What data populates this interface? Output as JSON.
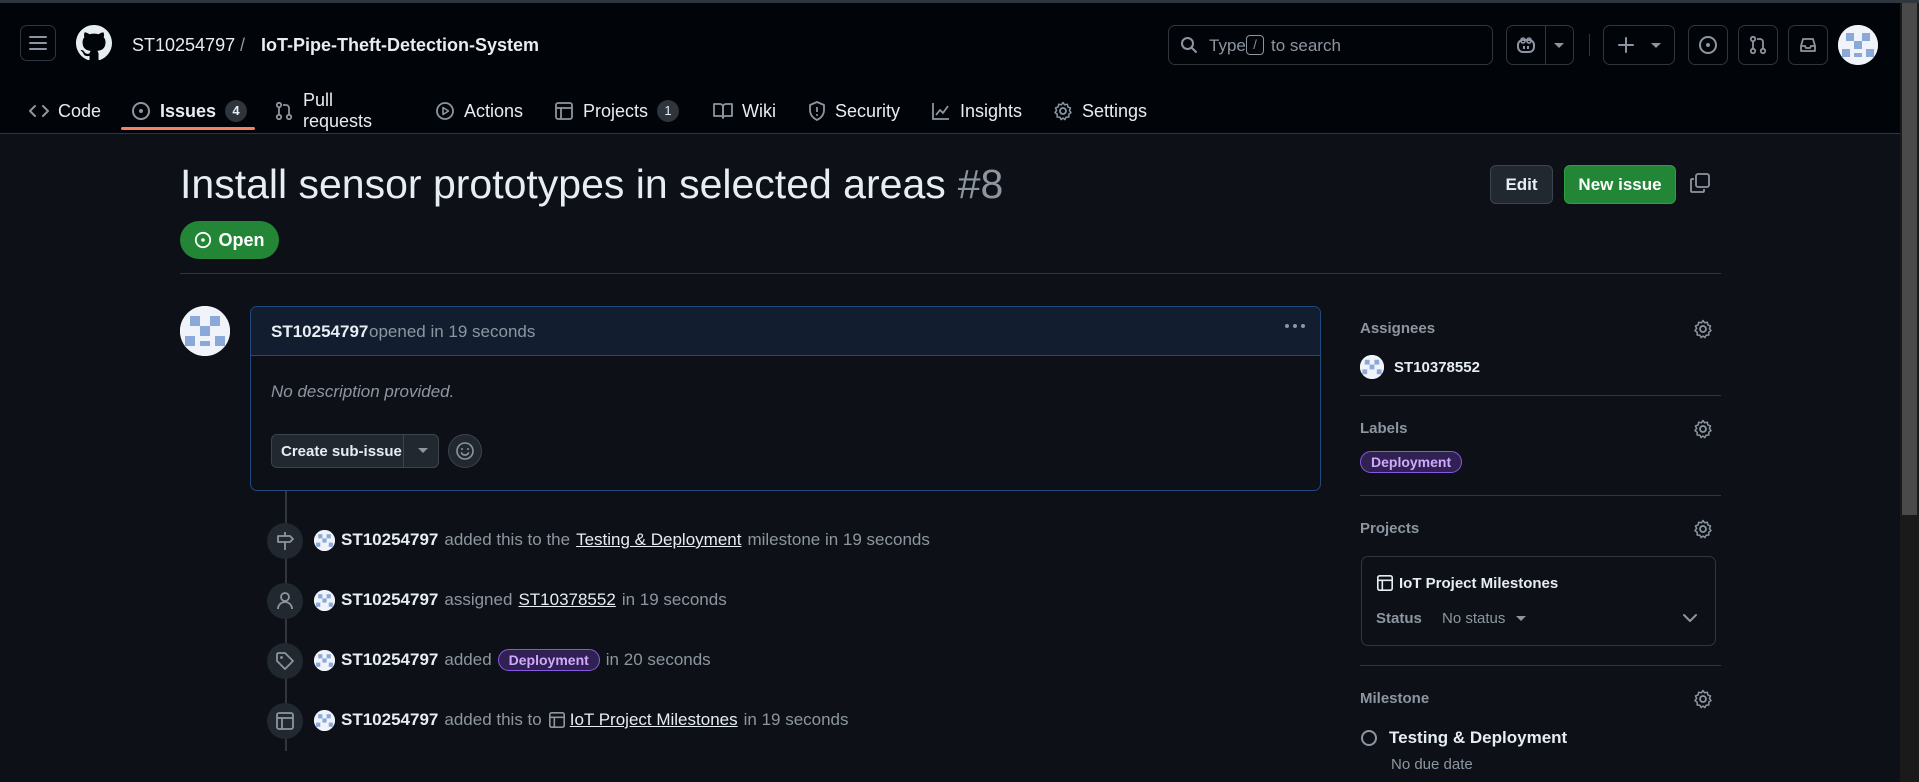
{
  "repo": {
    "owner": "ST10254797",
    "separator": "/",
    "name": "IoT-Pipe-Theft-Detection-System"
  },
  "search": {
    "prefix": "Type",
    "key": "/",
    "suffix": "to search"
  },
  "tabs": [
    {
      "label": "Code",
      "icon": "code-icon"
    },
    {
      "label": "Issues",
      "icon": "issue-opened-icon",
      "count": "4",
      "active": true
    },
    {
      "label": "Pull requests",
      "icon": "git-pull-request-icon"
    },
    {
      "label": "Actions",
      "icon": "play-icon"
    },
    {
      "label": "Projects",
      "icon": "table-icon",
      "count": "1"
    },
    {
      "label": "Wiki",
      "icon": "book-icon"
    },
    {
      "label": "Security",
      "icon": "shield-icon"
    },
    {
      "label": "Insights",
      "icon": "graph-icon"
    },
    {
      "label": "Settings",
      "icon": "gear-icon"
    }
  ],
  "issue": {
    "title": "Install sensor prototypes in selected areas",
    "number": "#8",
    "state": "Open",
    "edit_label": "Edit",
    "new_issue_label": "New issue"
  },
  "comment": {
    "author": "ST10254797",
    "opened_text": "opened in 19 seconds",
    "body": "No description provided.",
    "sub_issue_label": "Create sub-issue"
  },
  "timeline": [
    {
      "icon": "milestone-icon",
      "actor": "ST10254797",
      "text1": "added this to the",
      "link": "Testing & Deployment",
      "text2": "milestone in 19 seconds"
    },
    {
      "icon": "person-icon",
      "actor": "ST10254797",
      "text1": "assigned",
      "link": "ST10378552",
      "text2": "in 19 seconds"
    },
    {
      "icon": "tag-icon",
      "actor": "ST10254797",
      "text1": "added",
      "label": "Deployment",
      "text2": "in 20 seconds"
    },
    {
      "icon": "table-icon",
      "actor": "ST10254797",
      "text1": "added this to",
      "link": "IoT Project Milestones",
      "text2": "in 19 seconds"
    }
  ],
  "sidebar": {
    "assignees": {
      "heading": "Assignees",
      "user": "ST10378552"
    },
    "labels": {
      "heading": "Labels",
      "label": "Deployment"
    },
    "projects": {
      "heading": "Projects",
      "project": "IoT Project Milestones",
      "status_key": "Status",
      "status_value": "No status"
    },
    "milestone": {
      "heading": "Milestone",
      "name": "Testing & Deployment",
      "due": "No due date"
    }
  },
  "colors": {
    "background": "#0d1117",
    "header": "#010409",
    "open_green": "#238636",
    "label_purple": "#d2a8ff",
    "active_tab_underline": "#f78166"
  }
}
